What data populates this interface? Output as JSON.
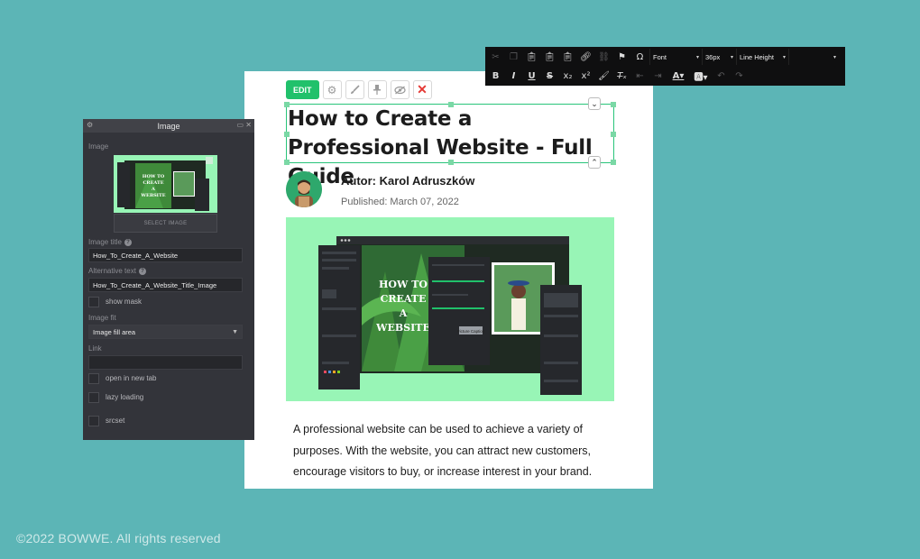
{
  "editor_toolbar": {
    "edit_label": "EDIT",
    "icons": [
      "gear-icon",
      "brush-icon",
      "pin-icon",
      "eye-slash-icon",
      "close-icon"
    ]
  },
  "article": {
    "title": "How to Create a Professional Website - Full Guide",
    "author": "Autor: Karol Adruszków",
    "published": "Published: March 07, 2022",
    "hero_title": "HOW TO CREATE A WEBSITE",
    "hero_tag": "Picture Caption",
    "body": "A professional website can be used to achieve a variety of purposes. With the website, you can attract new customers, encourage visitors to buy, or increase interest in your brand."
  },
  "image_panel": {
    "title": "Image",
    "image_label": "Image",
    "select_image_label": "SELECT IMAGE",
    "thumb_title": "HOW TO CREATE A WEBSITE",
    "image_title_label": "Image title",
    "image_title_value": "How_To_Create_A_Website",
    "alt_text_label": "Alternative text",
    "alt_text_value": "How_To_Create_A_Website_Title_Image",
    "show_mask_label": "show mask",
    "image_fit_label": "Image fit",
    "image_fit_value": "Image fill area",
    "link_label": "Link",
    "link_value": "",
    "open_new_tab_label": "open in new tab",
    "lazy_loading_label": "lazy loading",
    "srcset_label": "srcset"
  },
  "rt_toolbar": {
    "font_label": "Font",
    "size_label": "36px",
    "line_height_label": "Line Height",
    "bold": "B",
    "italic": "I",
    "underline": "U",
    "strike": "S"
  },
  "footer": "©2022 BOWWE. All rights reserved",
  "colors": {
    "background": "#5cb5b6",
    "accent_green": "#21c16b",
    "hero_bg": "#98f5b6",
    "panel_bg": "#33343a"
  }
}
